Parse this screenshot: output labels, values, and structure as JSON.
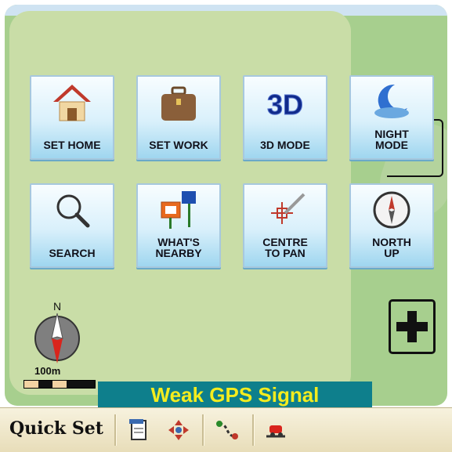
{
  "menu": {
    "buttons": [
      {
        "label": "SET HOME",
        "icon": "house-icon"
      },
      {
        "label": "SET WORK",
        "icon": "briefcase-icon"
      },
      {
        "label": "3D MODE",
        "icon": "3d-icon"
      },
      {
        "label": "NIGHT\nMODE",
        "icon": "moon-icon"
      },
      {
        "label": "SEARCH",
        "icon": "magnifier-icon"
      },
      {
        "label": "WHAT'S\nNEARBY",
        "icon": "poi-signs-icon"
      },
      {
        "label": "CENTRE\nTO PAN",
        "icon": "crosshair-pen-icon"
      },
      {
        "label": "NORTH\nUP",
        "icon": "compass-dial-icon"
      }
    ],
    "three_d_text": "3D"
  },
  "map": {
    "compass_letter": "N",
    "scale_label": "100m",
    "gps_status": "Weak GPS Signal"
  },
  "toolbar": {
    "label": "Quick Set",
    "icons": [
      "notepad-icon",
      "pan-arrows-icon",
      "route-icon",
      "traffic-icon"
    ]
  },
  "colors": {
    "map_green": "#a7cf8e",
    "banner_bg": "#0e7f8c",
    "banner_text": "#f4ec1e"
  }
}
